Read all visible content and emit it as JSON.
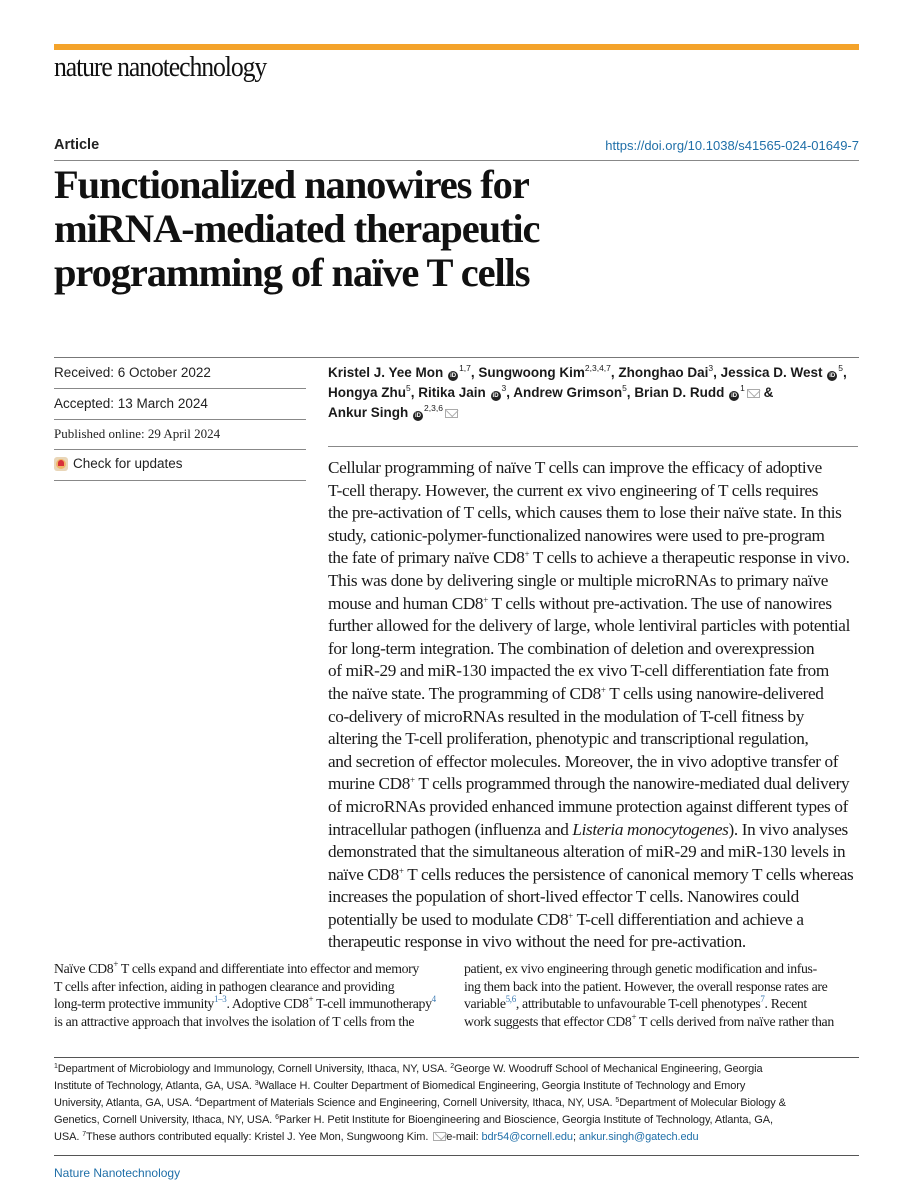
{
  "header": {
    "accent_color": "#f4a32a",
    "journal_logo": "nature nanotechnology",
    "article_type": "Article",
    "doi": "https://doi.org/10.1038/s41565-024-01649-7"
  },
  "title_lines": [
    "Functionalized nanowires for",
    "miRNA-mediated therapeutic",
    "programming of naïve T cells"
  ],
  "meta": {
    "received": "Received: 6 October 2022",
    "accepted": "Accepted: 13 March 2024",
    "published": "Published online: 29 April 2024",
    "check_updates": "Check for updates"
  },
  "authors": [
    {
      "name": "Kristel J. Yee Mon",
      "sup": "1,7",
      "orcid": true,
      "sep": ", "
    },
    {
      "name": "Sungwoong Kim",
      "sup": "2,3,4,7",
      "orcid": false,
      "sep": ", "
    },
    {
      "name": "Zhonghao Dai",
      "sup": "3",
      "orcid": false,
      "sep": ", "
    },
    {
      "name": "Jessica D. West",
      "sup": "5",
      "orcid": true,
      "sep": ", "
    },
    {
      "name": "Hongya Zhu",
      "sup": "5",
      "orcid": false,
      "sep": ", "
    },
    {
      "name": "Ritika Jain",
      "sup": "3",
      "orcid": true,
      "sep": ", "
    },
    {
      "name": "Andrew Grimson",
      "sup": "5",
      "orcid": false,
      "sep": ", "
    },
    {
      "name": "Brian D. Rudd",
      "sup": "1",
      "orcid": true,
      "mail": true,
      "sep": " & "
    },
    {
      "name": "Ankur Singh",
      "sup": "2,3,6",
      "orcid": true,
      "mail": true,
      "sep": ""
    }
  ],
  "abstract_lines": [
    "Cellular programming of naïve T cells can improve the efficacy of adoptive",
    "T-cell therapy. However, the current ex vivo engineering of T cells requires",
    "the pre-activation of T cells, which causes them to lose their naïve state. In this",
    "study, cationic-polymer-functionalized nanowires were used to pre-program",
    "the fate of primary naïve CD8⁺ T cells to achieve a therapeutic response in vivo.",
    "This was done by delivering single or multiple microRNAs to primary naïve",
    "mouse and human CD8⁺ T cells without pre-activation. The use of nanowires",
    "further allowed for the delivery of large, whole lentiviral particles with potential",
    "for long-term integration. The combination of deletion and overexpression",
    "of miR-29 and miR-130 impacted the ex vivo T-cell differentiation fate from",
    "the naïve state. The programming of CD8⁺ T cells using nanowire-delivered",
    "co-delivery of microRNAs resulted in the modulation of T-cell fitness by",
    "altering the T-cell proliferation, phenotypic and transcriptional regulation,",
    "and secretion of effector molecules. Moreover, the in vivo adoptive transfer of",
    "murine CD8⁺ T cells programmed through the nanowire-mediated dual delivery",
    "of microRNAs provided enhanced immune protection against different types of",
    "intracellular pathogen (influenza and Listeria monocytogenes). In vivo analyses",
    "demonstrated that the simultaneous alteration of miR-29 and miR-130 levels in",
    "naïve CD8⁺ T cells reduces the persistence of canonical memory T cells whereas",
    "increases the population of short-lived effector T cells. Nanowires could",
    "potentially be used to modulate CD8⁺ T-cell differentiation and achieve a",
    "therapeutic response in vivo without the need for pre-activation."
  ],
  "body_left_lines": [
    "Naïve CD8⁺ T cells expand and differentiate into effector and memory",
    "T cells after infection, aiding in pathogen clearance and providing",
    "long-term protective immunity¹⁻³. Adoptive CD8⁺ T-cell immunotherapy⁴",
    "is an attractive approach that involves the isolation of T cells from the"
  ],
  "body_right_lines": [
    "patient, ex vivo engineering through genetic modification and infus-",
    "ing them back into the patient. However, the overall response rates are",
    "variable⁵,⁶, attributable to unfavourable T-cell phenotypes⁷. Recent",
    "work suggests that effector CD8⁺ T cells derived from naïve rather than"
  ],
  "affiliations_lines": [
    "¹Department of Microbiology and Immunology, Cornell University, Ithaca, NY, USA. ²George W. Woodruff School of Mechanical Engineering, Georgia",
    "Institute of Technology, Atlanta, GA, USA. ³Wallace H. Coulter Department of Biomedical Engineering, Georgia Institute of Technology and Emory",
    "University, Atlanta, GA, USA. ⁴Department of Materials Science and Engineering, Cornell University, Ithaca, NY, USA. ⁵Department of Molecular Biology &",
    "Genetics, Cornell University, Ithaca, NY, USA. ⁶Parker H. Petit Institute for Bioengineering and Bioscience, Georgia Institute of Technology, Atlanta, GA,",
    "USA. ⁷These authors contributed equally: Kristel J. Yee Mon, Sungwoong Kim."
  ],
  "contact": {
    "email_label": "e-mail: ",
    "emails": [
      "bdr54@cornell.edu",
      "ankur.singh@gatech.edu"
    ],
    "separator": "; "
  },
  "footer": {
    "journal_name": "Nature Nanotechnology"
  }
}
